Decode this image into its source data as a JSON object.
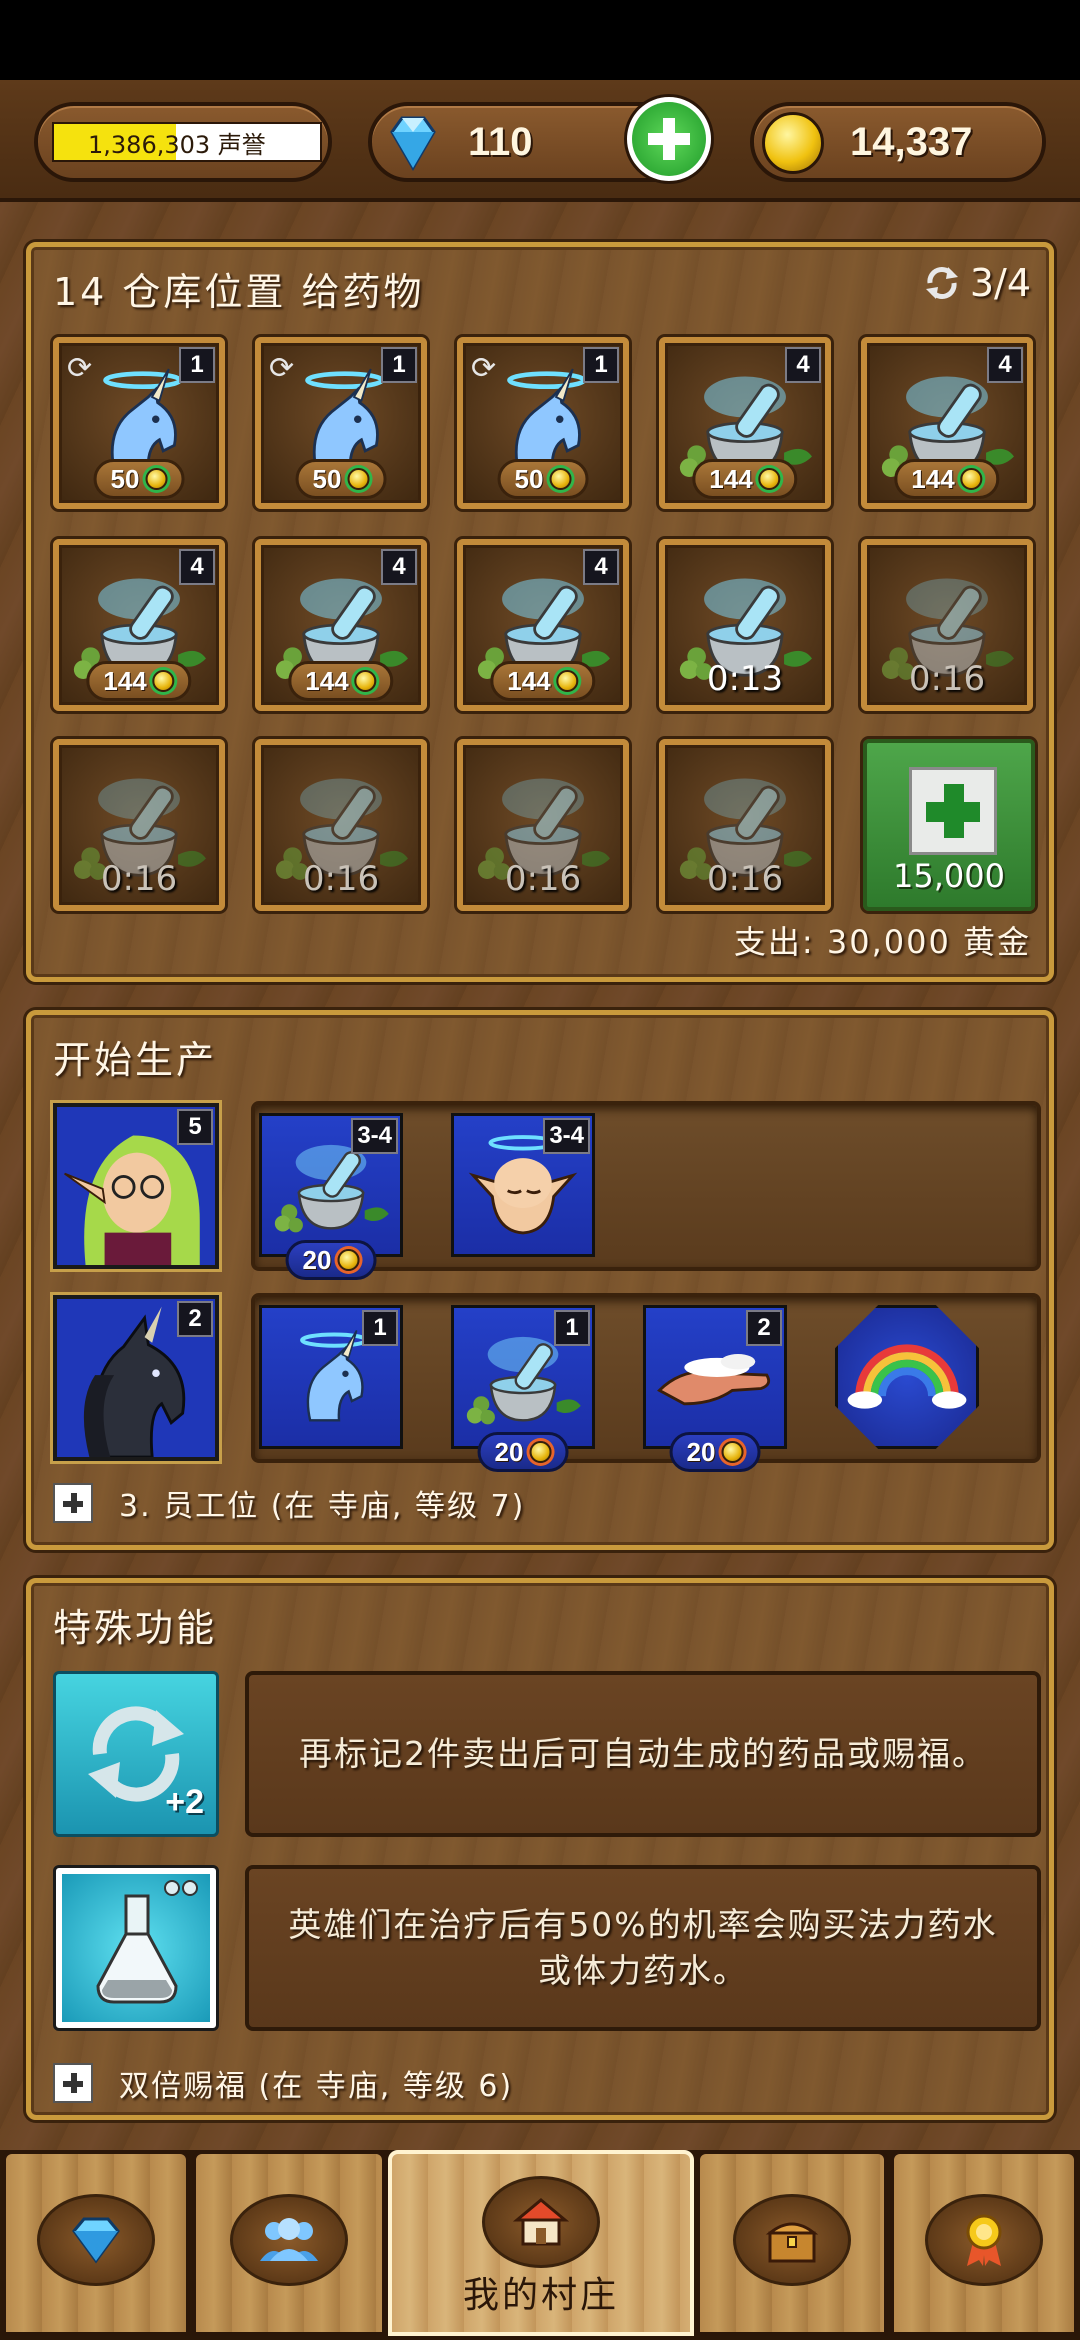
{
  "topbar": {
    "fame_label": "1,386,303 声誉",
    "fame_progress": 0.46,
    "gems": "110",
    "gold": "14,337",
    "gem_icon": "diamond-icon",
    "add_icon": "plus-icon",
    "gold_icon": "gold-coin-icon"
  },
  "storage": {
    "title": "14 仓库位置 给药物",
    "auto_count": "3/4",
    "row1": [
      {
        "item": "unicorn-blessing",
        "qty": "1",
        "price": "50",
        "auto": true
      },
      {
        "item": "unicorn-blessing",
        "qty": "1",
        "price": "50",
        "auto": true
      },
      {
        "item": "unicorn-blessing",
        "qty": "1",
        "price": "50",
        "auto": true
      },
      {
        "item": "mortar-potion",
        "qty": "4",
        "price": "144"
      },
      {
        "item": "mortar-potion",
        "qty": "4",
        "price": "144"
      }
    ],
    "row2": [
      {
        "item": "mortar-potion",
        "qty": "4",
        "price": "144"
      },
      {
        "item": "mortar-potion",
        "qty": "4",
        "price": "144"
      },
      {
        "item": "mortar-potion",
        "qty": "4",
        "price": "144"
      },
      {
        "item": "mortar-potion",
        "timer": "0:13"
      },
      {
        "item": "mortar-potion",
        "timer": "0:16"
      }
    ],
    "row3": [
      {
        "item": "mortar-potion",
        "timer": "0:16"
      },
      {
        "item": "mortar-potion",
        "timer": "0:16"
      },
      {
        "item": "mortar-potion",
        "timer": "0:16"
      },
      {
        "item": "mortar-potion",
        "timer": "0:16"
      }
    ],
    "add_slot_price": "15,000",
    "expense": "支出: 30,000 黄金"
  },
  "production": {
    "title": "开始生产",
    "workers": [
      {
        "name": "elf-worker",
        "level": "5",
        "items": [
          {
            "item": "mortar-potion",
            "qty": "3-4",
            "price": "20"
          },
          {
            "item": "elf-blessing",
            "qty": "3-4"
          }
        ]
      },
      {
        "name": "unicorn-worker",
        "level": "2",
        "items": [
          {
            "item": "unicorn-blessing",
            "qty": "1"
          },
          {
            "item": "mortar-potion",
            "qty": "1",
            "price": "20"
          },
          {
            "item": "healing-hands",
            "qty": "2",
            "price": "20"
          },
          {
            "item": "rainbow-blessing"
          }
        ]
      }
    ],
    "add_worker": "3. 员工位 (在 寺庙, 等级 7)"
  },
  "special": {
    "title": "特殊功能",
    "features": [
      {
        "icon": "auto-restock-icon",
        "icon_label": "+2",
        "text": "再标记2件卖出后可自动生成的药品或赐福。"
      },
      {
        "icon": "potion-flask-icon",
        "text": "英雄们在治疗后有50%的机率会购买法力药水或体力药水。"
      }
    ],
    "add_feature": "双倍赐福 (在 寺庙, 等级 6)"
  },
  "nav": {
    "tabs": [
      {
        "icon": "gem-shop-icon"
      },
      {
        "icon": "heroes-icon"
      },
      {
        "icon": "village-home-icon",
        "label": "我的村庄",
        "active": true
      },
      {
        "icon": "treasure-chest-icon"
      },
      {
        "icon": "achievement-medal-icon"
      }
    ]
  },
  "colors": {
    "accent_green": "#2fb64a",
    "gold": "#e7b40c",
    "panel_border": "#c99a3c"
  }
}
